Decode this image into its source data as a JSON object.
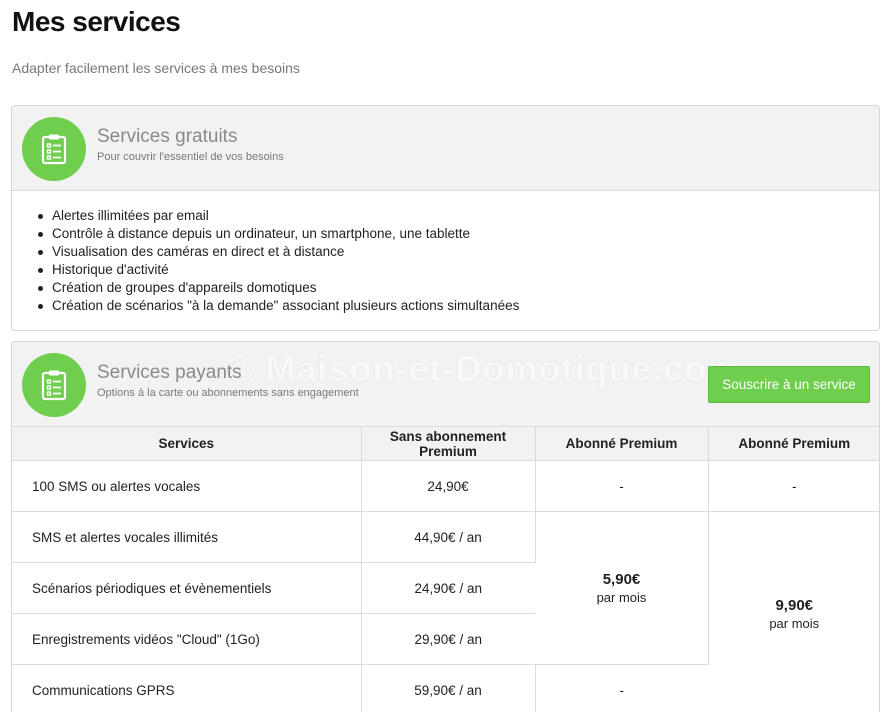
{
  "page": {
    "title": "Mes services",
    "subtitle": "Adapter facilement les services à mes besoins"
  },
  "free_services": {
    "title": "Services gratuits",
    "description": "Pour couvrir l'essentiel de vos besoins",
    "icon": "clipboard-list-icon",
    "features": [
      "Alertes illimitées par email",
      "Contrôle à distance depuis un ordinateur, un smartphone, une tablette",
      "Visualisation des caméras en direct et à distance",
      "Historique d'activité",
      "Création de groupes d'appareils domotiques",
      "Création de scénarios \"à la demande\" associant plusieurs actions simultanées"
    ]
  },
  "paid_services": {
    "title": "Services payants",
    "description": "Options à la carte ou abonnements sans engagement",
    "icon": "clipboard-list-icon",
    "watermark": "© Maison-et-Domotique.com",
    "subscribe_label": "Souscrire à un service",
    "columns": [
      "Services",
      "Sans abonnement Premium",
      "Abonné Premium",
      "Abonné Premium"
    ],
    "rows": [
      {
        "service": "100 SMS ou alertes vocales",
        "price": "24,90€",
        "premium1": "-",
        "premium2": "-"
      },
      {
        "service": "SMS et alertes vocales illimités",
        "price": "44,90€ / an"
      },
      {
        "service": "Scénarios périodiques et évènementiels",
        "price": "24,90€ / an"
      },
      {
        "service": "Enregistrements vidéos \"Cloud\" (1Go)",
        "price": "29,90€ / an"
      },
      {
        "service": "Communications GPRS",
        "price": "59,90€ / an",
        "premium1": "-"
      }
    ],
    "premium1_bundle": {
      "price": "5,90€",
      "period": "par mois"
    },
    "premium2_bundle": {
      "price": "9,90€",
      "period": "par mois"
    }
  },
  "colors": {
    "accent": "#6fce4e",
    "header_bg": "#f2f2f2",
    "border": "#dcdcdc"
  }
}
